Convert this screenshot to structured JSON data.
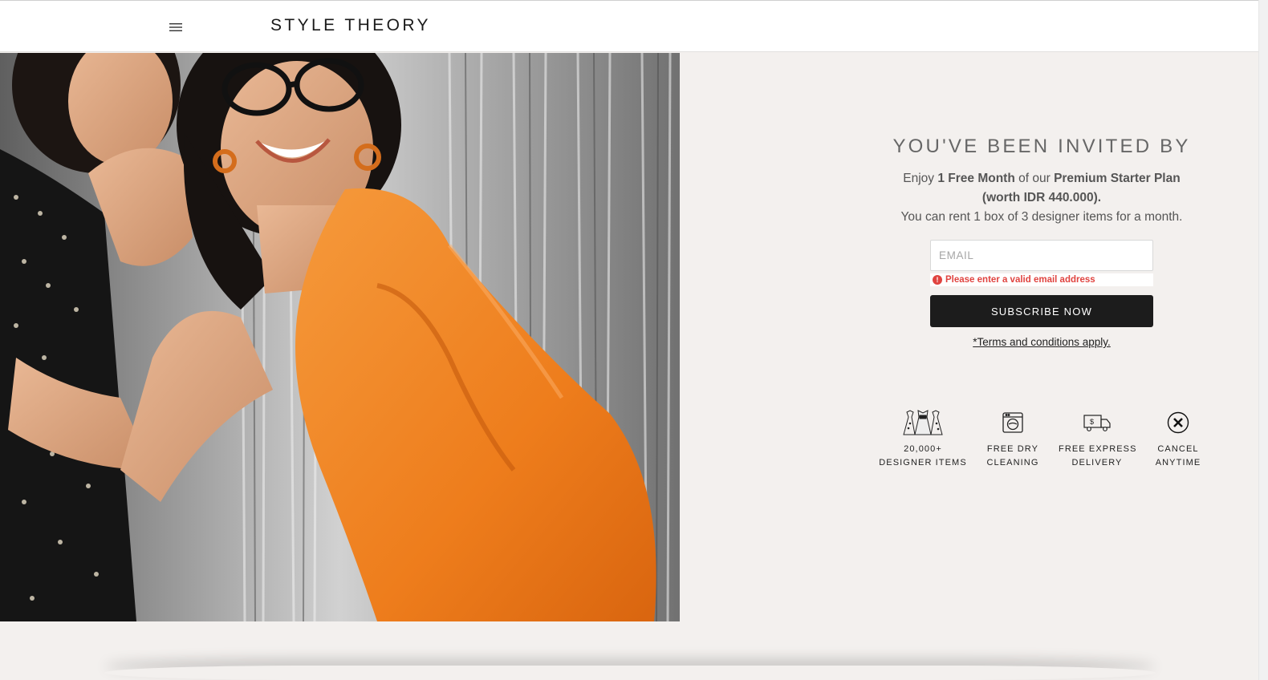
{
  "header": {
    "logo": "STYLE THEORY",
    "menu_icon": "hamburger-menu-icon"
  },
  "hero": {
    "image_subject": "two smiling women in front of silver tinsel curtain, one in orange sequin dress"
  },
  "invite": {
    "headline": "YOU'VE BEEN INVITED BY",
    "line1_prefix": "Enjoy ",
    "line1_bold1": "1 Free Month",
    "line1_mid": " of our ",
    "line1_bold2": "Premium Starter Plan",
    "line2_bold": "(worth IDR 440.000).",
    "line3": "You can rent 1 box of 3 designer items for a month.",
    "email_placeholder": "EMAIL",
    "email_value": "",
    "error_text": "Please enter a valid email address",
    "subscribe_label": "SUBSCRIBE NOW",
    "terms_label": "*Terms and conditions apply."
  },
  "features": [
    {
      "icon": "dresses-icon",
      "line1": "20,000+",
      "line2": "DESIGNER ITEMS"
    },
    {
      "icon": "washing-machine-icon",
      "line1": "FREE DRY",
      "line2": "CLEANING"
    },
    {
      "icon": "delivery-truck-icon",
      "line1": "FREE EXPRESS",
      "line2": "DELIVERY"
    },
    {
      "icon": "cancel-circle-icon",
      "line1": "CANCEL",
      "line2": "ANYTIME"
    }
  ],
  "colors": {
    "page_bg": "#f3f0ee",
    "button_bg": "#1c1c1c",
    "error": "#e0433f",
    "dress_orange": "#f07e1e"
  }
}
